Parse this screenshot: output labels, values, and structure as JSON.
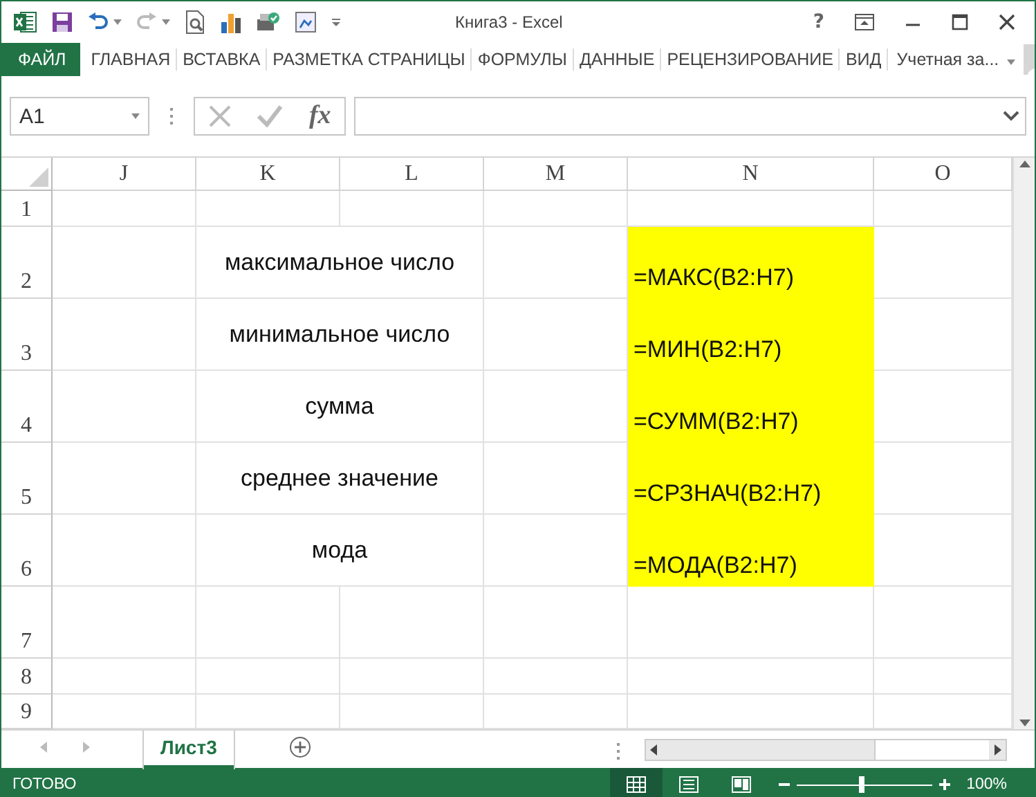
{
  "window": {
    "title": "Книга3 - Excel",
    "help": "?"
  },
  "ribbon": {
    "tabs": [
      {
        "label": "ФАЙЛ",
        "kind": "file",
        "selected": false
      },
      {
        "label": "ГЛАВНАЯ",
        "kind": "tab",
        "selected": false
      },
      {
        "label": "ВСТАВКА",
        "kind": "tab",
        "selected": false
      },
      {
        "label": "РАЗМЕТКА СТРАНИЦЫ",
        "kind": "tab",
        "selected": false
      },
      {
        "label": "ФОРМУЛЫ",
        "kind": "tab",
        "selected": false
      },
      {
        "label": "ДАННЫЕ",
        "kind": "tab",
        "selected": false
      },
      {
        "label": "РЕЦЕНЗИРОВАНИЕ",
        "kind": "tab",
        "selected": false
      },
      {
        "label": "ВИД",
        "kind": "tab",
        "selected": false
      }
    ],
    "account": "Учетная за..."
  },
  "formula_bar": {
    "name_box": "A1",
    "fx": "fx"
  },
  "sheet": {
    "columns": [
      {
        "label": "J"
      },
      {
        "label": "K"
      },
      {
        "label": "L"
      },
      {
        "label": "M"
      },
      {
        "label": "N"
      },
      {
        "label": "O"
      }
    ],
    "rows": [
      {
        "number": "1",
        "highlighted": false
      },
      {
        "number": "2",
        "label": "максимальное число",
        "formula": "=МАКС(B2:H7)",
        "highlighted": true
      },
      {
        "number": "3",
        "label": "минимальное число",
        "formula": "=МИН(B2:H7)",
        "highlighted": true
      },
      {
        "number": "4",
        "label": "сумма",
        "formula": "=СУММ(B2:H7)",
        "highlighted": true
      },
      {
        "number": "5",
        "label": "среднее значение",
        "formula": "=СРЗНАЧ(B2:H7)",
        "highlighted": true
      },
      {
        "number": "6",
        "label": "мода",
        "formula": "=МОДА(B2:H7)",
        "highlighted": true
      },
      {
        "number": "7",
        "highlighted": false
      },
      {
        "number": "8",
        "highlighted": false
      },
      {
        "number": "9",
        "highlighted": false
      }
    ]
  },
  "sheet_tabs": [
    {
      "label": "Лист3",
      "selected": true
    }
  ],
  "status_bar": {
    "status": "ГОТОВО",
    "zoom": {
      "level": 0.48,
      "reading": "100%"
    }
  }
}
